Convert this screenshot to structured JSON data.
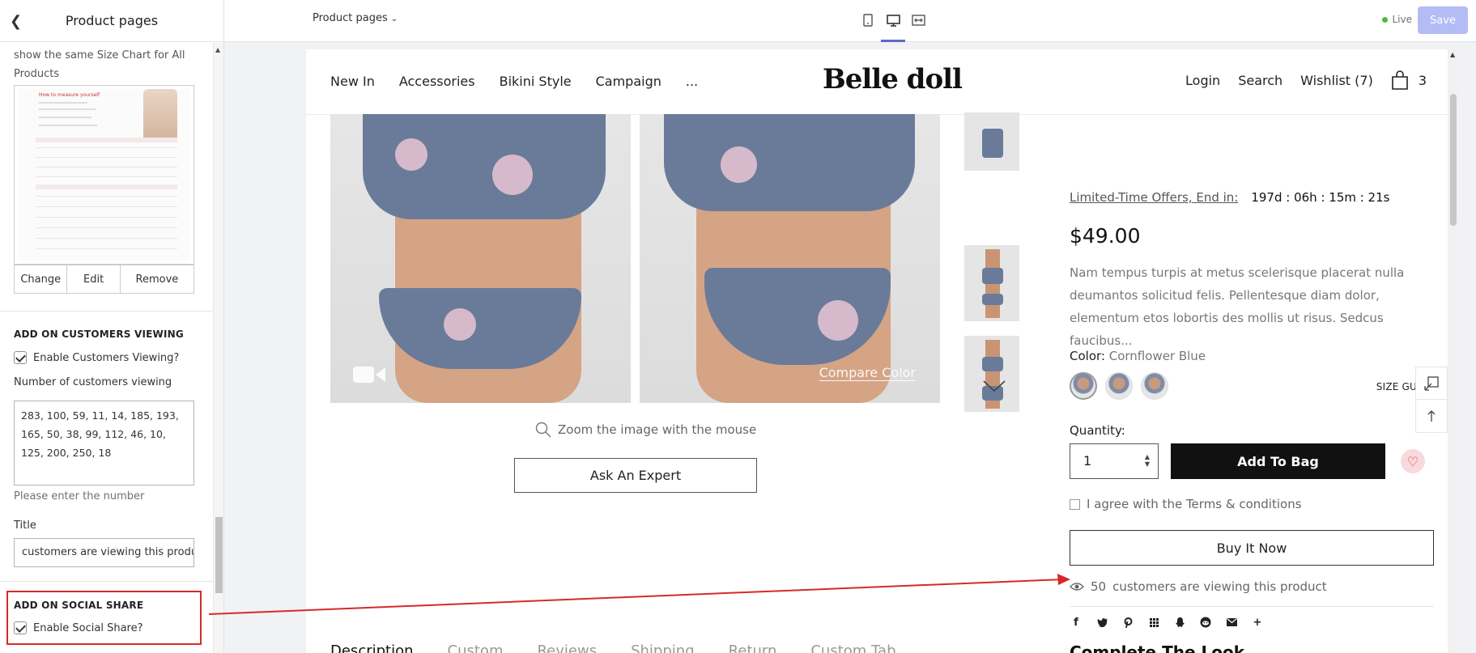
{
  "sidebar": {
    "title": "Product pages",
    "size_chart_text": "show the same Size Chart for All Products",
    "size_chart_image_heading": "How to measure yourself",
    "image_buttons": [
      "Change",
      "Edit",
      "Remove"
    ],
    "customers_section": {
      "title": "ADD ON CUSTOMERS VIEWING",
      "enable_label": "Enable Customers Viewing?",
      "number_label": "Number of customers viewing",
      "number_value": "283, 100, 59, 11, 14, 185, 193, 165, 50, 38, 99, 112, 46, 10, 125, 200, 250, 18",
      "help": "Please enter the number",
      "title_label": "Title",
      "title_value": "customers are viewing this product"
    },
    "social_section": {
      "title": "ADD ON SOCIAL SHARE",
      "enable_label": "Enable Social Share?"
    }
  },
  "topbar": {
    "page_selector": "Product pages",
    "live_label": "Live",
    "save_label": "Save"
  },
  "store": {
    "nav_left": [
      "New In",
      "Accessories",
      "Bikini Style",
      "Campaign",
      "..."
    ],
    "logo": "Belle doll",
    "nav_right": {
      "login": "Login",
      "search": "Search",
      "wishlist": "Wishlist (7)",
      "cart_count": "3"
    },
    "compare_color": "Compare Color",
    "zoom_hint": "Zoom the image with the mouse",
    "ask_expert": "Ask An Expert",
    "tabs": [
      "Description",
      "Custom",
      "Reviews",
      "Shipping",
      "Return",
      "Custom Tab"
    ],
    "complete_look": "Complete The Look"
  },
  "product": {
    "offer_label": "Limited-Time Offers, End in:",
    "countdown": "197d : 06h : 15m : 21s",
    "price": "$49.00",
    "description": "Nam tempus turpis at metus scelerisque placerat nulla deumantos solicitud felis. Pellentesque diam dolor, elementum etos lobortis des mollis ut risus. Sedcus faucibus...",
    "color_label": "Color:",
    "color_value": "Cornflower Blue",
    "size_guide": "SIZE GUIDE",
    "quantity_label": "Quantity:",
    "quantity_value": "1",
    "add_to_bag": "Add To Bag",
    "agree_label": "I agree with the Terms & conditions",
    "buy_now": "Buy It Now",
    "viewing_count": "50",
    "viewing_text": "customers are viewing this product",
    "social_icons": [
      "facebook-icon",
      "twitter-icon",
      "pinterest-icon",
      "grid-icon",
      "snapchat-icon",
      "reddit-icon",
      "email-icon",
      "plus-icon"
    ]
  },
  "colors": {
    "accent": "#5c6ac4",
    "save_bg": "#b3bcf5",
    "annotation_red": "#d62a2a",
    "live_green": "#50b83c"
  }
}
